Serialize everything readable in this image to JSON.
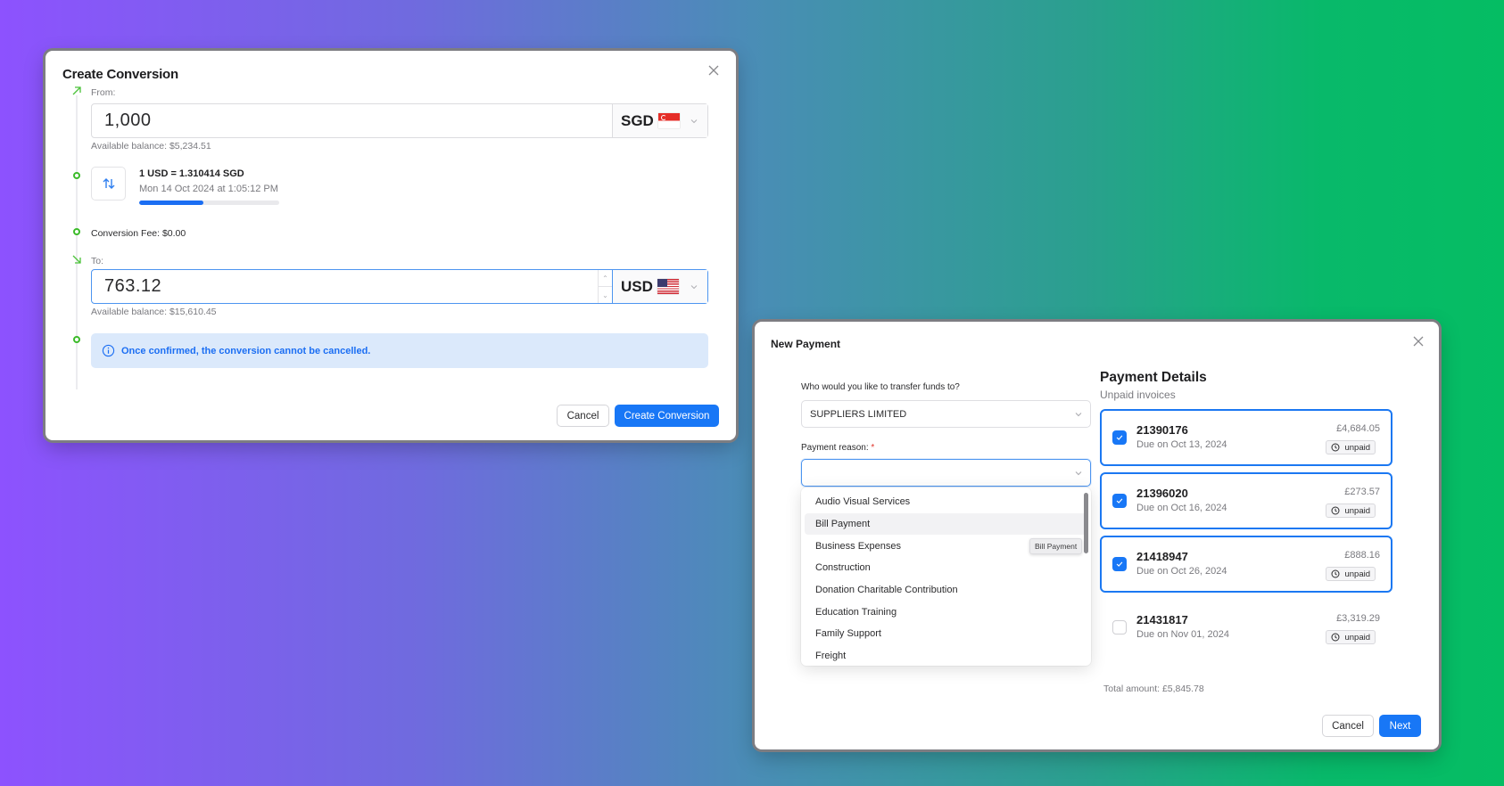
{
  "background": {
    "gradient": [
      "#8d52fe",
      "#4a8db6",
      "#05bd63"
    ]
  },
  "conversion_dialog": {
    "title": "Create Conversion",
    "from": {
      "label": "From:",
      "amount": "1,000",
      "currency": "SGD",
      "flag": "singapore-flag",
      "available_balance": "Available balance: $5,234.51"
    },
    "rate": {
      "text": "1 USD = 1.310414 SGD",
      "timestamp": "Mon 14 Oct 2024 at 1:05:12 PM",
      "refresh_progress_percent": 46
    },
    "fee": "Conversion Fee: $0.00",
    "to": {
      "label": "To:",
      "amount": "763.12",
      "currency": "USD",
      "flag": "us-flag",
      "available_balance": "Available balance: $15,610.45"
    },
    "notice": "Once confirmed, the conversion cannot be cancelled.",
    "buttons": {
      "cancel": "Cancel",
      "submit": "Create Conversion"
    },
    "colors": {
      "accent": "#1877f6",
      "timeline": "#3cbb2a",
      "notice_bg": "#dbe9fb"
    }
  },
  "payment_dialog": {
    "title": "New Payment",
    "recipient": {
      "label": "Who would you like to transfer funds to?",
      "value": "SUPPLIERS LIMITED"
    },
    "reason": {
      "label": "Payment reason:",
      "required_marker": "*",
      "value": "",
      "options": [
        "Audio Visual Services",
        "Bill Payment",
        "Business Expenses",
        "Construction",
        "Donation Charitable Contribution",
        "Education Training",
        "Family Support",
        "Freight"
      ],
      "hovered_option": "Bill Payment",
      "tooltip": "Bill Payment"
    },
    "details": {
      "title": "Payment Details",
      "subtitle": "Unpaid invoices",
      "invoices": [
        {
          "number": "21390176",
          "due": "Due on Oct 13, 2024",
          "amount": "£4,684.05",
          "status": "unpaid",
          "selected": true
        },
        {
          "number": "21396020",
          "due": "Due on Oct 16, 2024",
          "amount": "£273.57",
          "status": "unpaid",
          "selected": true
        },
        {
          "number": "21418947",
          "due": "Due on Oct 26, 2024",
          "amount": "£888.16",
          "status": "unpaid",
          "selected": true
        },
        {
          "number": "21431817",
          "due": "Due on Nov 01, 2024",
          "amount": "£3,319.29",
          "status": "unpaid",
          "selected": false
        }
      ],
      "total": "Total amount: £5,845.78"
    },
    "buttons": {
      "cancel": "Cancel",
      "next": "Next"
    }
  }
}
